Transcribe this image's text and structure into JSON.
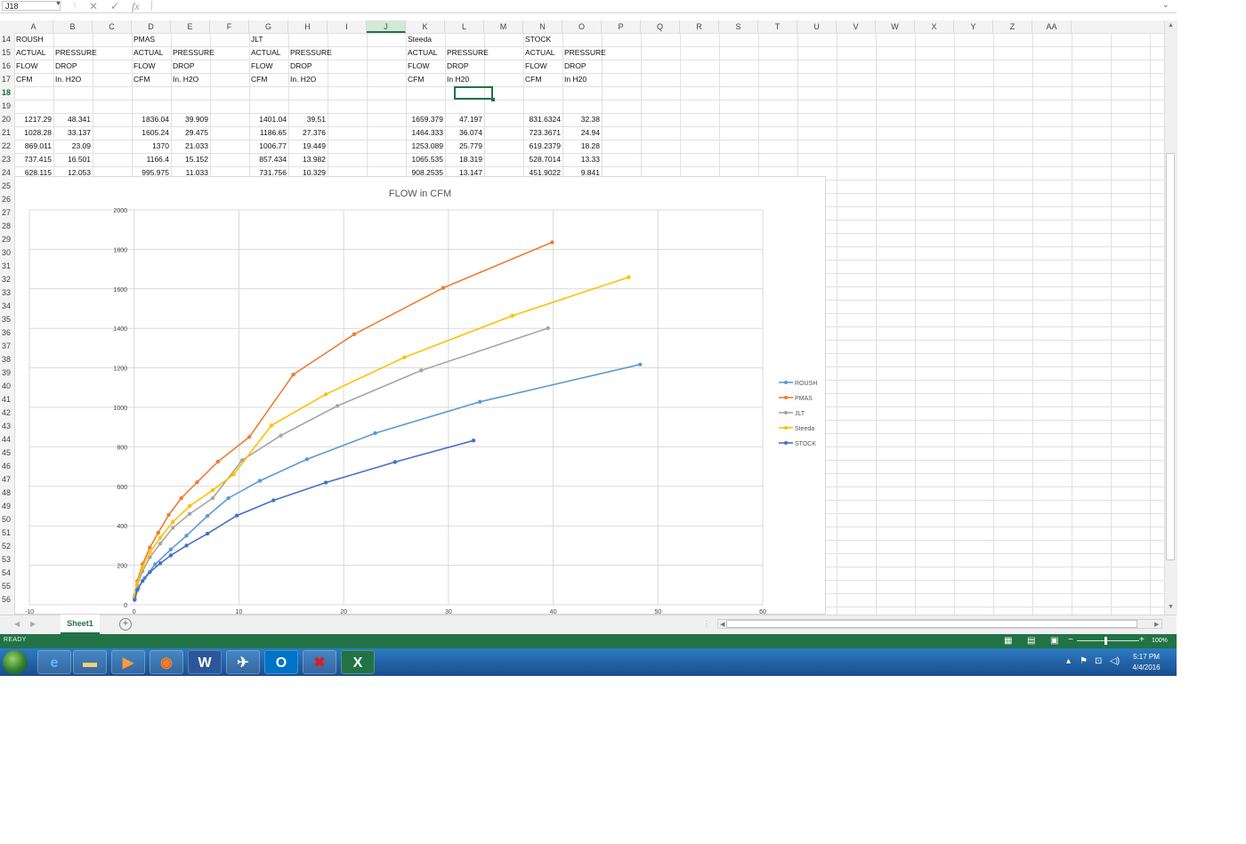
{
  "formula_bar": {
    "name_box": "J18",
    "cancel_icon": "✕",
    "enter_icon": "✓",
    "fx_label": "fx",
    "content": ""
  },
  "columns": [
    "A",
    "B",
    "C",
    "D",
    "E",
    "F",
    "G",
    "H",
    "I",
    "J",
    "K",
    "L",
    "M",
    "N",
    "O",
    "P",
    "Q",
    "R",
    "S",
    "T",
    "U",
    "V",
    "W",
    "X",
    "Y",
    "Z",
    "AA"
  ],
  "selected_column": "J",
  "rows": [
    "14",
    "15",
    "16",
    "17",
    "18",
    "19",
    "20",
    "21",
    "22",
    "23",
    "24",
    "25",
    "26",
    "27",
    "28",
    "29",
    "30",
    "31",
    "32",
    "33",
    "34",
    "35",
    "36",
    "37",
    "38",
    "39",
    "40",
    "41",
    "42",
    "43",
    "44",
    "45",
    "46",
    "47",
    "48",
    "49",
    "50",
    "51",
    "52",
    "53",
    "54",
    "55",
    "56"
  ],
  "selected_row": "18",
  "cells": {
    "A14": "ROUSH",
    "D14": "PMAS",
    "G14": "JLT",
    "K14": "Steeda",
    "N14": "STOCK",
    "A15": "ACTUAL",
    "B15": "PRESSURE",
    "D15": "ACTUAL",
    "E15": "PRESSURE",
    "G15": "ACTUAL",
    "H15": "PRESSURE",
    "K15": "ACTUAL",
    "L15": "PRESSURE",
    "N15": "ACTUAL",
    "O15": "PRESSURE",
    "A16": "FLOW",
    "B16": "DROP",
    "D16": "FLOW",
    "E16": "DROP",
    "G16": "FLOW",
    "H16": "DROP",
    "K16": "FLOW",
    "L16": "DROP",
    "N16": "FLOW",
    "O16": "DROP",
    "A17": "CFM",
    "B17": "In. H2O",
    "D17": "CFM",
    "E17": "In. H2O",
    "G17": "CFM",
    "H17": "In. H2O",
    "K17": "CFM",
    "L17": "In H20",
    "N17": "CFM",
    "O17": "In H20"
  },
  "data_rows": [
    {
      "row": "20",
      "A": "1217.29",
      "B": "48.341",
      "D": "1836.04",
      "E": "39.909",
      "G": "1401.04",
      "H": "39.51",
      "K": "1659.379",
      "L": "47.197",
      "N": "831.6324",
      "O": "32.38"
    },
    {
      "row": "21",
      "A": "1028.28",
      "B": "33.137",
      "D": "1605.24",
      "E": "29.475",
      "G": "1186.65",
      "H": "27.376",
      "K": "1464.333",
      "L": "36.074",
      "N": "723.3671",
      "O": "24.94"
    },
    {
      "row": "22",
      "A": "869.011",
      "B": "23.09",
      "D": "1370",
      "E": "21.033",
      "G": "1006.77",
      "H": "19.449",
      "K": "1253.089",
      "L": "25.779",
      "N": "619.2379",
      "O": "18.28"
    },
    {
      "row": "23",
      "A": "737.415",
      "B": "16.501",
      "D": "1166.4",
      "E": "15.152",
      "G": "857.434",
      "H": "13.982",
      "K": "1065.535",
      "L": "18.319",
      "N": "528.7014",
      "O": "13.33"
    },
    {
      "row": "24",
      "A": "628.115",
      "B": "12.053",
      "D": "995.975",
      "E": "11.033",
      "G": "731.756",
      "H": "10.329",
      "K": "908.2535",
      "L": "13.147",
      "N": "451.9022",
      "O": "9.841"
    }
  ],
  "chart_data": {
    "type": "scatter",
    "title": "FLOW in CFM",
    "xlabel": "",
    "ylabel": "",
    "xlim": [
      -10,
      60
    ],
    "ylim": [
      0,
      2000
    ],
    "x_ticks": [
      "-10",
      "0",
      "10",
      "20",
      "30",
      "40",
      "50",
      "60"
    ],
    "y_ticks": [
      "0",
      "200",
      "400",
      "600",
      "800",
      "1000",
      "1200",
      "1400",
      "1600",
      "1800",
      "2000"
    ],
    "grid": true,
    "legend_position": "right",
    "series": [
      {
        "name": "ROUSH",
        "color": "#5b9bd5",
        "points": [
          [
            0.05,
            30
          ],
          [
            0.4,
            85
          ],
          [
            1,
            135
          ],
          [
            2,
            205
          ],
          [
            3.5,
            280
          ],
          [
            5,
            350
          ],
          [
            7,
            450
          ],
          [
            9,
            540
          ],
          [
            12,
            628
          ],
          [
            16.5,
            737
          ],
          [
            23,
            869
          ],
          [
            33,
            1028
          ],
          [
            48.3,
            1217
          ]
        ]
      },
      {
        "name": "PMAS",
        "color": "#ed7d31",
        "points": [
          [
            0.05,
            45
          ],
          [
            0.3,
            120
          ],
          [
            0.8,
            205
          ],
          [
            1.5,
            290
          ],
          [
            2.3,
            365
          ],
          [
            3.3,
            455
          ],
          [
            4.5,
            540
          ],
          [
            6,
            620
          ],
          [
            8,
            725
          ],
          [
            11,
            850
          ],
          [
            15.2,
            1166
          ],
          [
            21,
            1370
          ],
          [
            29.5,
            1605
          ],
          [
            39.9,
            1836
          ]
        ]
      },
      {
        "name": "JLT",
        "color": "#a5a5a5",
        "points": [
          [
            0.05,
            35
          ],
          [
            0.3,
            100
          ],
          [
            0.8,
            170
          ],
          [
            1.5,
            240
          ],
          [
            2.5,
            310
          ],
          [
            3.7,
            390
          ],
          [
            5.3,
            460
          ],
          [
            7.5,
            540
          ],
          [
            10.3,
            732
          ],
          [
            14,
            857
          ],
          [
            19.4,
            1007
          ],
          [
            27.4,
            1187
          ],
          [
            39.5,
            1401
          ]
        ]
      },
      {
        "name": "Steeda",
        "color": "#ffc000",
        "points": [
          [
            0.05,
            40
          ],
          [
            0.3,
            110
          ],
          [
            0.8,
            190
          ],
          [
            1.5,
            265
          ],
          [
            2.5,
            340
          ],
          [
            3.7,
            420
          ],
          [
            5.3,
            500
          ],
          [
            7.5,
            580
          ],
          [
            9.5,
            660
          ],
          [
            13.1,
            908
          ],
          [
            18.3,
            1066
          ],
          [
            25.8,
            1253
          ],
          [
            36.1,
            1464
          ],
          [
            47.2,
            1659
          ]
        ]
      },
      {
        "name": "STOCK",
        "color": "#4472c4",
        "points": [
          [
            0.05,
            25
          ],
          [
            0.3,
            75
          ],
          [
            0.8,
            120
          ],
          [
            1.5,
            165
          ],
          [
            2.5,
            210
          ],
          [
            3.5,
            250
          ],
          [
            5,
            300
          ],
          [
            7,
            360
          ],
          [
            9.8,
            452
          ],
          [
            13.3,
            529
          ],
          [
            18.3,
            619
          ],
          [
            24.9,
            723
          ],
          [
            32.4,
            832
          ]
        ]
      }
    ]
  },
  "sheet_tab": "Sheet1",
  "add_sheet_icon": "+",
  "status": {
    "text": "READY",
    "zoom": "100%"
  },
  "taskbar": {
    "apps": [
      "ie-icon",
      "folder-icon",
      "media-icon",
      "firefox-icon",
      "word-icon",
      "store-icon",
      "outlook-icon",
      "app-icon",
      "excel-icon"
    ],
    "time": "5:17 PM",
    "date": "4/4/2016"
  },
  "colors": {
    "excel_green": "#217346",
    "taskbar_blue": "#1f5a9e"
  }
}
